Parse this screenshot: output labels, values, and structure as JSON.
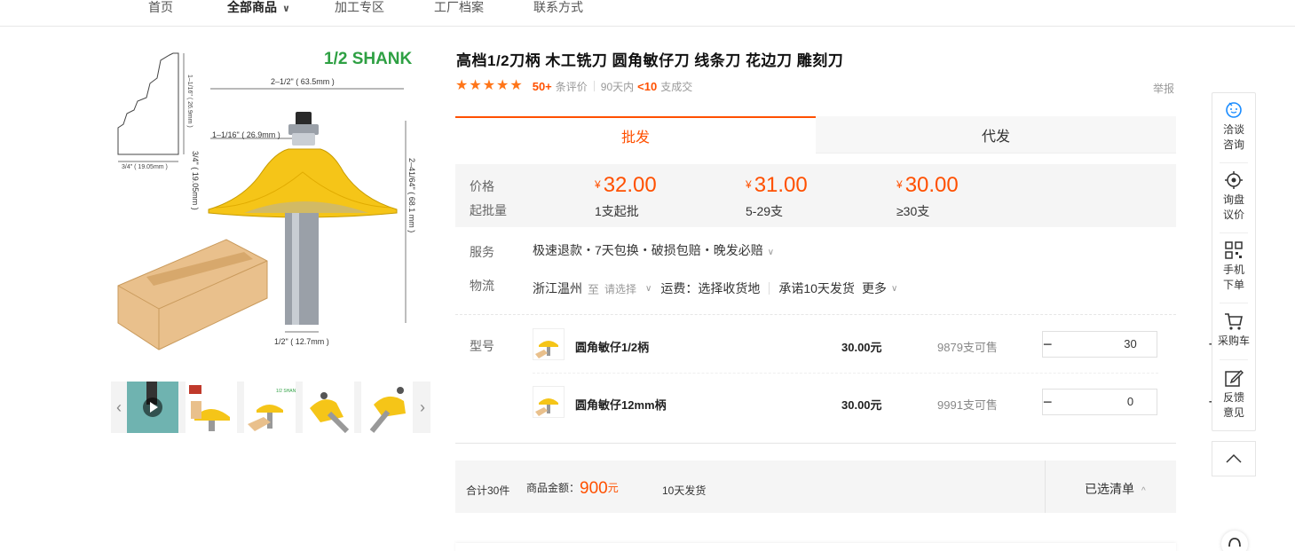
{
  "nav": {
    "home": "首页",
    "all_products": "全部商品",
    "processing": "加工专区",
    "factory": "工厂档案",
    "contact": "联系方式"
  },
  "gallery": {
    "shank_label": "1/2 SHANK",
    "dims": {
      "width_top": "2–1/2\" ( 63.5mm )",
      "cutter_width": "1–1/16\" ( 26.9mm )",
      "cut_height": "3/4\" ( 19.05mm )",
      "overall_height": "2–41/64\" ( 68.1 mm )",
      "shank_dia": "1/2\" ( 12.7mm )",
      "profile_side": "1–1/16\" ( 26.9mm )",
      "profile_bottom": "3/4\"  ( 19.05mm )"
    },
    "thumbnail_count": 5
  },
  "product": {
    "title": "高档1/2刀柄 木工铣刀 圆角敏仔刀 线条刀 花边刀 雕刻刀",
    "rating_stars": 5,
    "reviews_count": "50+",
    "reviews_label": "条评价",
    "sold_period": "90天内",
    "sold_count": "<10",
    "sold_label": "支成交",
    "report": "举报"
  },
  "tabs": {
    "wholesale": "批发",
    "dropship": "代发"
  },
  "pricing": {
    "price_label": "价格",
    "moq_label": "起批量",
    "currency": "¥",
    "tiers": [
      {
        "price": "32.00",
        "qty": "1支起批"
      },
      {
        "price": "31.00",
        "qty": "5-29支"
      },
      {
        "price": "30.00",
        "qty": "≥30支"
      }
    ]
  },
  "service": {
    "label": "服务",
    "text": "极速退款・7天包换・破损包赔・晚发必赔"
  },
  "logistics": {
    "label": "物流",
    "origin": "浙江温州",
    "to": "至",
    "select": "请选择",
    "freight": "运费：选择收货地",
    "promise": "承诺10天发货",
    "more": "更多"
  },
  "sku": {
    "label": "型号",
    "items": [
      {
        "name": "圆角敏仔1/2柄",
        "price": "30.00元",
        "stock": "9879支可售",
        "qty": "30"
      },
      {
        "name": "圆角敏仔12mm柄",
        "price": "30.00元",
        "stock": "9991支可售",
        "qty": "0"
      }
    ]
  },
  "summary": {
    "total_qty": "合计30件",
    "amount_label": "商品金额：",
    "amount": "900",
    "amount_unit": "元",
    "ship": "10天发货",
    "selected_list": "已选清单"
  },
  "sidebar": {
    "chat": [
      "洽谈",
      "咨询"
    ],
    "inquiry": [
      "询盘",
      "议价"
    ],
    "mobile": [
      "手机",
      "下单"
    ],
    "cart": [
      "采购车"
    ],
    "feedback": [
      "反馈",
      "意见"
    ]
  },
  "colors": {
    "accent": "#ff5000",
    "star": "#ff7519",
    "bit_yellow": "#f5c518",
    "shank_green": "#2ea043",
    "sidebar_blue": "#1a8cff"
  }
}
